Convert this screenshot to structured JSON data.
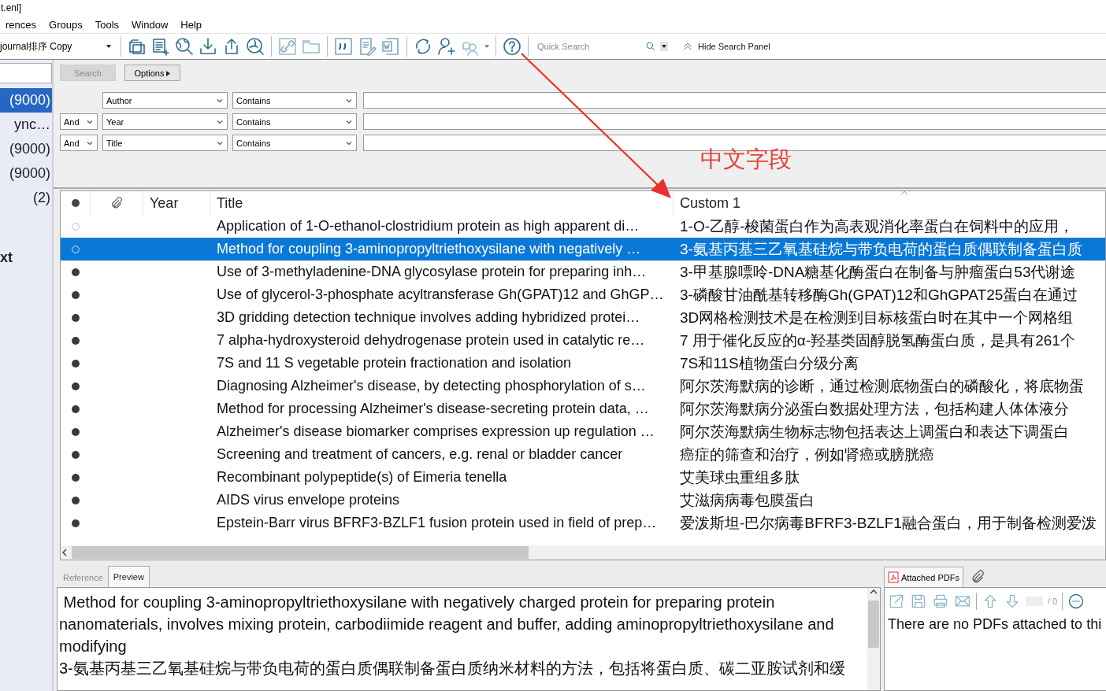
{
  "window": {
    "title": "t.enl]"
  },
  "menu": [
    "rences",
    "Groups",
    "Tools",
    "Window",
    "Help"
  ],
  "toolbar": {
    "style_select": "journal排序 Copy",
    "quick_search": {
      "placeholder": "Quick Search"
    },
    "hide_panel": "Hide Search Panel"
  },
  "sidebar": {
    "items": [
      {
        "label": "(9000)",
        "kind": "group",
        "selected": true
      },
      {
        "label": "ync…",
        "kind": "group",
        "selected": false
      },
      {
        "label": "(9000)",
        "kind": "group",
        "selected": false
      },
      {
        "label": "(9000)",
        "kind": "group",
        "selected": false
      },
      {
        "label": "(2)",
        "kind": "group",
        "selected": false
      },
      {
        "label": "xt",
        "kind": "heading",
        "selected": false
      }
    ]
  },
  "search_panel": {
    "search_button": "Search",
    "search_disabled": true,
    "options_button": "Options",
    "rows": [
      {
        "field": "Author",
        "operator": "Contains"
      },
      {
        "connector": "And",
        "field": "Year",
        "operator": "Contains"
      },
      {
        "connector": "And",
        "field": "Title",
        "operator": "Contains"
      }
    ]
  },
  "table": {
    "columns": [
      {
        "kind": "read-dot"
      },
      {
        "kind": "attachment"
      },
      {
        "kind": "text",
        "label": "Year"
      },
      {
        "kind": "text",
        "label": "Title"
      },
      {
        "kind": "text",
        "label": "Custom 1"
      }
    ],
    "rows": [
      {
        "unread": false,
        "selected": false,
        "title": "Application of 1-O-ethanol-clostridium protein as high apparent di…",
        "custom_1": "1-O-乙醇-梭菌蛋白作为高表观消化率蛋白在饲料中的应用，"
      },
      {
        "unread": false,
        "selected": true,
        "title": "Method for coupling 3-aminopropyltriethoxysilane with negatively …",
        "custom_1": "3-氨基丙基三乙氧基硅烷与带负电荷的蛋白质偶联制备蛋白质"
      },
      {
        "unread": true,
        "selected": false,
        "title": "Use of 3-methyladenine-DNA glycosylase protein for preparing inh…",
        "custom_1": "3-甲基腺嘌呤-DNA糖基化酶蛋白在制备与肿瘤蛋白53代谢途"
      },
      {
        "unread": true,
        "selected": false,
        "title": "Use of glycerol-3-phosphate acyltransferase Gh(GPAT)12 and GhGP…",
        "custom_1": "3-磷酸甘油酰基转移酶Gh(GPAT)12和GhGPAT25蛋白在通过"
      },
      {
        "unread": true,
        "selected": false,
        "title": "3D gridding detection technique involves adding hybridized protei…",
        "custom_1": "3D网格检测技术是在检测到目标核蛋白时在其中一个网格组"
      },
      {
        "unread": true,
        "selected": false,
        "title": "7 alpha-hydroxysteroid dehydrogenase protein used in catalytic re…",
        "custom_1": "7 用于催化反应的α-羟基类固醇脱氢酶蛋白质，是具有261个"
      },
      {
        "unread": true,
        "selected": false,
        "title": "7S and 11 S vegetable protein fractionation and isolation",
        "custom_1": "7S和11S植物蛋白分级分离"
      },
      {
        "unread": true,
        "selected": false,
        "title": "Diagnosing Alzheimer's disease, by detecting phosphorylation of s…",
        "custom_1": "阿尔茨海默病的诊断，通过检测底物蛋白的磷酸化，将底物蛋"
      },
      {
        "unread": true,
        "selected": false,
        "title": "Method for processing Alzheimer's disease-secreting protein data, …",
        "custom_1": "阿尔茨海默病分泌蛋白数据处理方法，包括构建人体体液分"
      },
      {
        "unread": true,
        "selected": false,
        "title": "Alzheimer's disease biomarker comprises expression up regulation …",
        "custom_1": "阿尔茨海默病生物标志物包括表达上调蛋白和表达下调蛋白"
      },
      {
        "unread": true,
        "selected": false,
        "title": "Screening and treatment of cancers, e.g. renal or bladder cancer",
        "custom_1": "癌症的筛查和治疗，例如肾癌或膀胱癌"
      },
      {
        "unread": true,
        "selected": false,
        "title": "Recombinant polypeptide(s) of Eimeria tenella",
        "custom_1": "艾美球虫重组多肽"
      },
      {
        "unread": true,
        "selected": false,
        "title": "AIDS virus envelope proteins",
        "custom_1": "艾滋病病毒包膜蛋白"
      },
      {
        "unread": true,
        "selected": false,
        "title": "Epstein-Barr virus BFRF3-BZLF1 fusion protein used in field of prep…",
        "custom_1": "爱泼斯坦-巴尔病毒BFRF3-BZLF1融合蛋白，用于制备检测爱泼"
      }
    ]
  },
  "preview": {
    "tabs": [
      {
        "label": "Reference",
        "selected": false
      },
      {
        "label": "Preview",
        "selected": true
      }
    ],
    "lines": [
      " Method for coupling 3-aminopropyltriethoxysilane with negatively charged protein for preparing protein",
      "nanomaterials, involves mixing protein, carbodiimide reagent and buffer, adding aminopropyltriethoxysilane and",
      "modifying",
      "3-氨基丙基三乙氧基硅烷与带负电荷的蛋白质偶联制备蛋白质纳米材料的方法，包括将蛋白质、碳二亚胺试剂和缓"
    ]
  },
  "pdf_panel": {
    "tab": "Attached PDFs",
    "page_count": "/ 0",
    "message": "There are no PDFs attached to thi"
  },
  "annotation": {
    "label": "中文字段"
  }
}
